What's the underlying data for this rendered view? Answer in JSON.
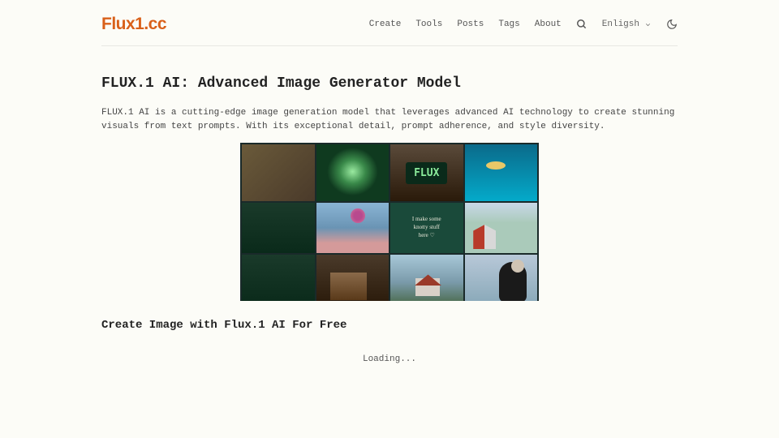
{
  "logo": "Flux1.cc",
  "nav": {
    "create": "Create",
    "tools": "Tools",
    "posts": "Posts",
    "tags": "Tags",
    "about": "About"
  },
  "language": "Enligsh",
  "main_title": "FLUX.1 AI: Advanced Image Generator Model",
  "intro": "FLUX.1 AI is a cutting-edge image generation model that leverages advanced AI technology to create stunning visuals from text prompts. With its exceptional detail, prompt adherence, and style diversity.",
  "sub_title": "Create Image with Flux.1 AI For Free",
  "loading": "Loading..."
}
